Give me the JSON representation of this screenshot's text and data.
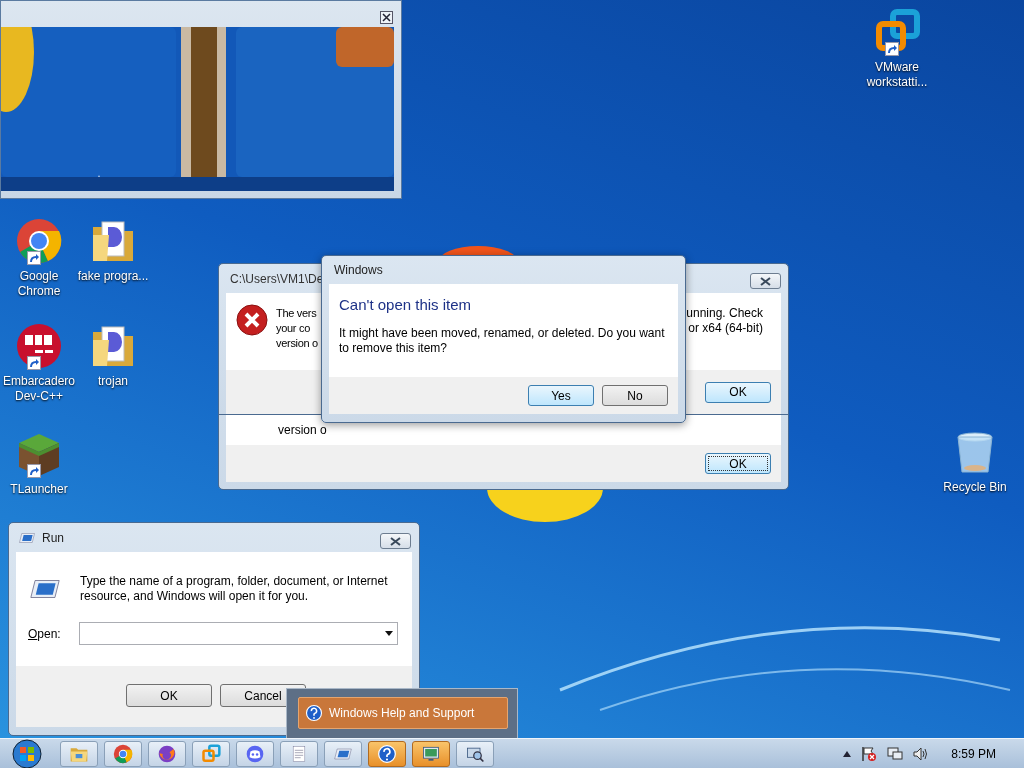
{
  "desktop_icons": [
    {
      "label": "Google Chrome",
      "kind": "chrome",
      "shortcut": true
    },
    {
      "label": "fake progra...",
      "kind": "folder",
      "shortcut": false
    },
    {
      "label": "Embarcadero Dev-C++",
      "kind": "devcpp",
      "shortcut": true
    },
    {
      "label": "trojan",
      "kind": "folder",
      "shortcut": false
    },
    {
      "label": "TLauncher",
      "kind": "grass",
      "shortcut": true
    },
    {
      "label": "VMware workstatti...",
      "kind": "vmware",
      "shortcut": true
    },
    {
      "label": "Recycle Bin",
      "kind": "recycle",
      "shortcut": false
    }
  ],
  "error_dialog_back": {
    "text": "version o",
    "button": "OK"
  },
  "error_dialog_front": {
    "title": "C:\\Users\\VM1\\De",
    "text_left": [
      "The vers",
      "your co",
      "version o"
    ],
    "text_right": [
      "unning. Check",
      "or x64 (64-bit)"
    ],
    "button": "OK"
  },
  "message_dialog": {
    "title": "Windows",
    "heading": "Can't open this item",
    "message": "It might have been moved, renamed, or deleted. Do you want to remove this item?",
    "buttons": [
      {
        "label": "Yes",
        "default": true
      },
      {
        "label": "No",
        "default": false
      }
    ]
  },
  "run_dialog": {
    "title": "Run",
    "description": "Type the name of a program, folder, document, or Internet resource, and Windows will open it for you.",
    "open_label": "Open:",
    "buttons": [
      "OK",
      "Cancel"
    ]
  },
  "jump_menu": {
    "items": [
      {
        "label": "Windows Help and Support",
        "selected": true
      }
    ]
  },
  "taskbar": {
    "apps": [
      {
        "kind": "explorer",
        "highlighted": false
      },
      {
        "kind": "chrome",
        "highlighted": false
      },
      {
        "kind": "firefox",
        "highlighted": false
      },
      {
        "kind": "vmware",
        "highlighted": false
      },
      {
        "kind": "discord",
        "highlighted": false
      },
      {
        "kind": "notepad",
        "highlighted": false
      },
      {
        "kind": "run",
        "highlighted": false
      },
      {
        "kind": "help",
        "highlighted": true
      },
      {
        "kind": "remote",
        "highlighted": true
      },
      {
        "kind": "magnifier",
        "highlighted": false
      }
    ],
    "clock": "8:59 PM"
  }
}
